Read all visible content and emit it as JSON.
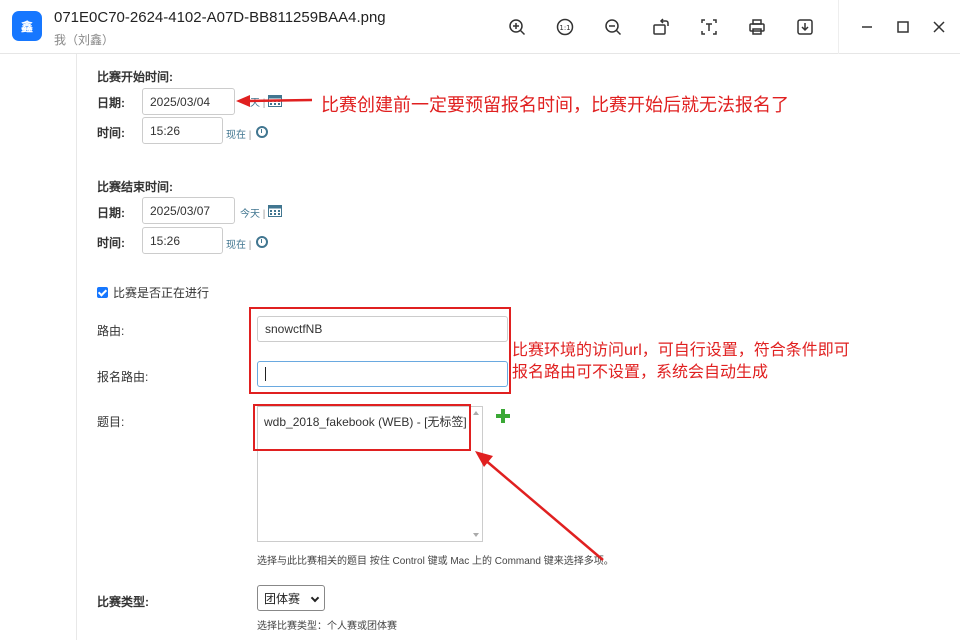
{
  "window": {
    "title": "071E0C70-2624-4102-A07D-BB811259BAA4.png",
    "subtitle": "我（刘鑫）",
    "app_icon_text": "鑫",
    "toolbar": [
      "zoom-in",
      "actual-size",
      "zoom-out",
      "rotate",
      "crop-text",
      "print",
      "download"
    ],
    "window_controls": [
      "minimize",
      "maximize",
      "close"
    ]
  },
  "form": {
    "start_section": "比赛开始时间:",
    "end_section": "比赛结束时间:",
    "date_label": "日期:",
    "time_label": "时间:",
    "start_date": "2025/03/04",
    "start_time": "15:26",
    "end_date": "2025/03/07",
    "end_time": "15:26",
    "today_link": "今天",
    "now_link": "现在",
    "start_today_visible": "天",
    "link_sep": "|",
    "in_progress_label": "比赛是否正在进行",
    "in_progress_checked": true,
    "route_label": "路由:",
    "route_value": "snowctfNB",
    "signup_route_label": "报名路由:",
    "signup_route_value": "",
    "problems_label": "题目:",
    "problems_options": [
      "wdb_2018_fakebook (WEB) - [无标签]"
    ],
    "problems_help": "选择与此比赛相关的题目 按住 Control 键或 Mac 上的 Command 键来选择多项。",
    "type_label": "比赛类型:",
    "type_value": "团体赛",
    "type_help": "选择比赛类型：个人赛或团体赛"
  },
  "annotations": {
    "note1": "比赛创建前一定要预留报名时间，比赛开始后就无法报名了",
    "note2_line1": "比赛环境的访问url，可自行设置，符合条件即可",
    "note2_line2": "报名路由可不设置，系统会自动生成",
    "color": "#e02020"
  },
  "colors": {
    "accent": "#1677ff",
    "link": "#417690",
    "add": "#3aa835"
  }
}
